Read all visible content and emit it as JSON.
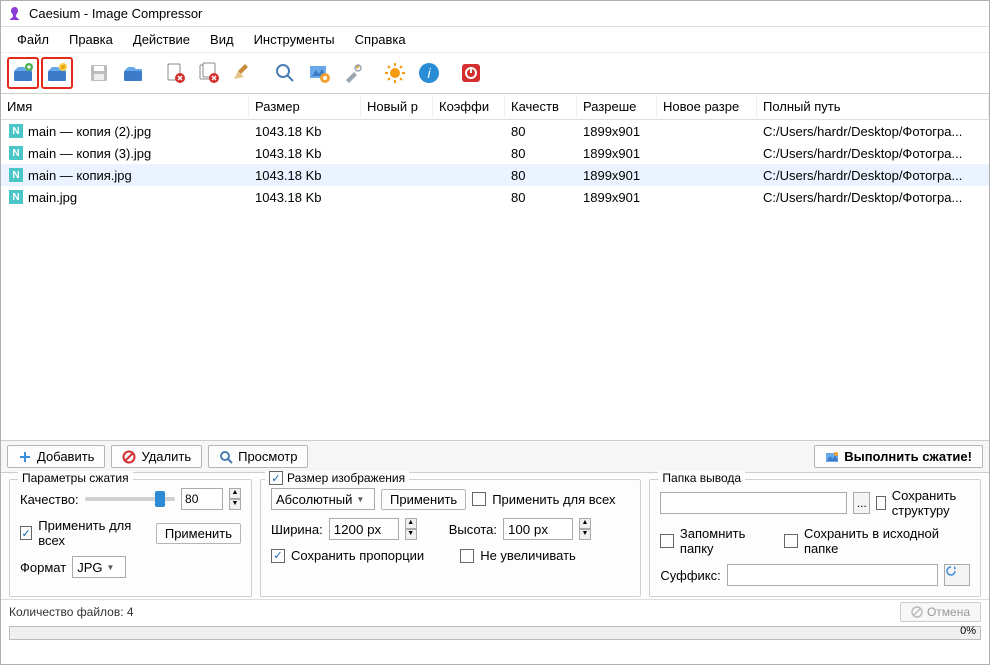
{
  "title": "Caesium - Image Compressor",
  "menu": [
    "Файл",
    "Правка",
    "Действие",
    "Вид",
    "Инструменты",
    "Справка"
  ],
  "toolbar_icons": [
    "add-files",
    "add-folder",
    "save",
    "open-folder",
    "remove-file",
    "remove-all",
    "clean",
    "zoom",
    "preview",
    "tools",
    "sun",
    "info",
    "power"
  ],
  "columns": {
    "name": "Имя",
    "size": "Размер",
    "newsize": "Новый р",
    "coef": "Коэффи",
    "qual": "Качеств",
    "res": "Разреше",
    "newres": "Новое разре",
    "path": "Полный путь"
  },
  "rows": [
    {
      "name": "main — копия (2).jpg",
      "size": "1043.18 Kb",
      "newsize": "",
      "coef": "",
      "qual": "80",
      "res": "1899x901",
      "newres": "",
      "path": "C:/Users/hardr/Desktop/Фотогра...",
      "sel": false
    },
    {
      "name": "main — копия (3).jpg",
      "size": "1043.18 Kb",
      "newsize": "",
      "coef": "",
      "qual": "80",
      "res": "1899x901",
      "newres": "",
      "path": "C:/Users/hardr/Desktop/Фотогра...",
      "sel": false
    },
    {
      "name": "main — копия.jpg",
      "size": "1043.18 Kb",
      "newsize": "",
      "coef": "",
      "qual": "80",
      "res": "1899x901",
      "newres": "",
      "path": "C:/Users/hardr/Desktop/Фотогра...",
      "sel": true
    },
    {
      "name": "main.jpg",
      "size": "1043.18 Kb",
      "newsize": "",
      "coef": "",
      "qual": "80",
      "res": "1899x901",
      "newres": "",
      "path": "C:/Users/hardr/Desktop/Фотогра...",
      "sel": false
    }
  ],
  "action_bar": {
    "add": "Добавить",
    "del": "Удалить",
    "preview": "Просмотр",
    "compress": "Выполнить сжатие!"
  },
  "group1": {
    "legend": "Параметры сжатия",
    "quality_label": "Качество:",
    "quality_value": "80",
    "apply_all": "Применить для всех",
    "apply_btn": "Применить",
    "format_label": "Формат",
    "format_value": "JPG"
  },
  "group2": {
    "legend": "Размер изображения",
    "enabled": true,
    "mode": "Абсолютный",
    "apply_btn": "Применить",
    "apply_all": "Применить для всех",
    "width_label": "Ширина:",
    "width_value": "1200 px",
    "height_label": "Высота:",
    "height_value": "100 px",
    "keep_ratio": "Сохранить пропорции",
    "no_upscale": "Не увеличивать"
  },
  "group3": {
    "legend": "Папка вывода",
    "browse": "...",
    "keep_struct": "Сохранить структуру",
    "remember": "Запомнить папку",
    "same_folder": "Сохранить в исходной папке",
    "suffix_label": "Суффикс:",
    "refresh": "⟳"
  },
  "status": {
    "count_label": "Количество файлов: 4",
    "cancel": "Отмена",
    "pct": "0%"
  }
}
